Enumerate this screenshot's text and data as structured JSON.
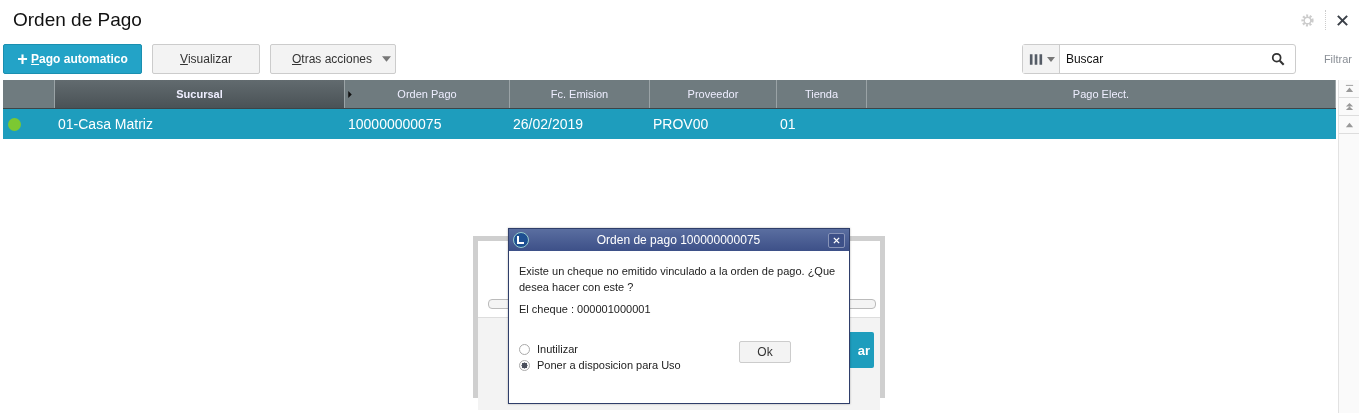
{
  "window": {
    "title": "Orden de Pago"
  },
  "toolbar": {
    "buttons": [
      {
        "kind": "primary",
        "icon": "+",
        "label": "Pago automatico"
      },
      {
        "kind": "plain",
        "label": "Visualizar"
      },
      {
        "kind": "dropdown",
        "label": "Otras acciones"
      }
    ]
  },
  "search": {
    "placeholder": "Buscar"
  },
  "filter_link": "Filtrar",
  "table": {
    "columns": [
      "",
      "Sucursal",
      "Orden Pago",
      "Fc. Emision",
      "Proveedor",
      "Tienda",
      "Pago Elect."
    ],
    "rows": [
      {
        "color": "#7cc832",
        "selected": true,
        "cells": [
          "",
          "01-Casa Matriz",
          "100000000075",
          "26/02/2019",
          "PROV00",
          "01",
          ""
        ]
      }
    ]
  },
  "background_dialog": {
    "progress": {
      "level": 0
    },
    "button_fragment": "ar"
  },
  "dialog": {
    "title": "Orden de pago 100000000075",
    "message": "Existe un cheque no emitido vinculado a la orden de pago. ¿Que desea hacer con este ?",
    "cheque": "El cheque : 000001000001",
    "options": [
      {
        "label": "Inutilizar",
        "selected": false
      },
      {
        "label": "Poner a disposicion para Uso",
        "selected": true
      }
    ],
    "ok": "Ok"
  }
}
